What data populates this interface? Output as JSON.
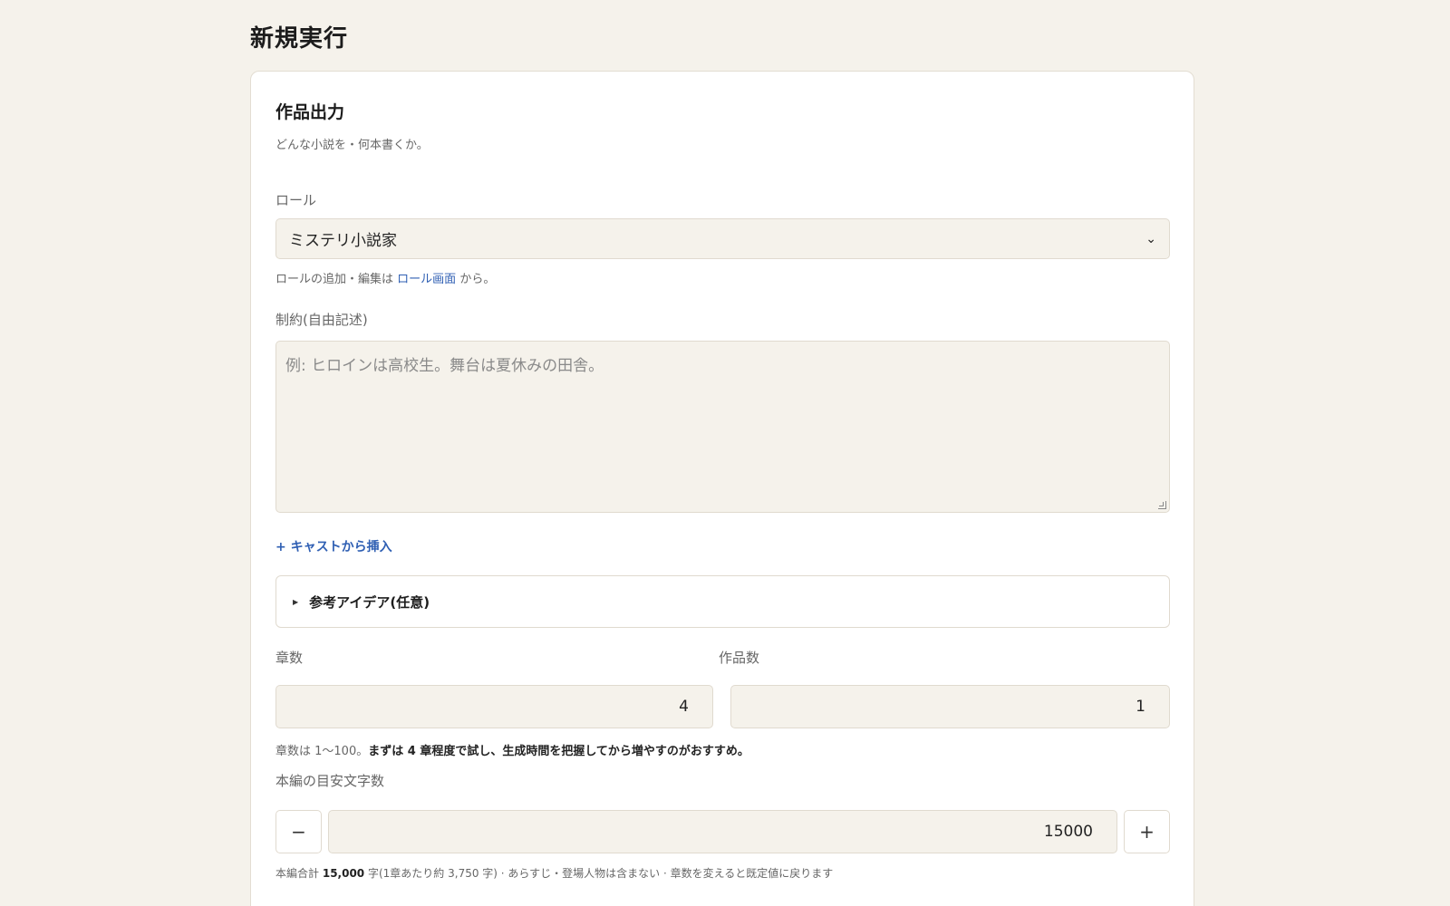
{
  "page": {
    "title": "新規実行"
  },
  "section": {
    "title": "作品出力",
    "description": "どんな小説を・何本書くか。"
  },
  "role": {
    "label": "ロール",
    "selected": "ミステリ小説家",
    "help_prefix": "ロールの追加・編集は",
    "help_link": "ロール画面",
    "help_suffix": "から。"
  },
  "constraints": {
    "label": "制約(自由記述)",
    "placeholder": "例: ヒロインは高校生。舞台は夏休みの田舎。"
  },
  "cast_insert": {
    "label": "+ キャストから挿入"
  },
  "reference": {
    "label": "参考アイデア(任意)"
  },
  "chapters": {
    "label": "章数",
    "value": "4",
    "hint_prefix": "章数は 1〜100。",
    "hint_bold": "まずは 4 章程度で試し、生成時間を把握してから増やすのがおすすめ。"
  },
  "works": {
    "label": "作品数",
    "value": "1"
  },
  "target_chars": {
    "label": "本編の目安文字数",
    "value": "15000",
    "minus": "−",
    "plus": "+",
    "foot_prefix": "本編合計",
    "foot_total": "15,000",
    "foot_suffix": "字(1章あたり約 3,750 字) · あらすじ・登場人物は含まない · 章数を変えると既定値に戻ります"
  }
}
